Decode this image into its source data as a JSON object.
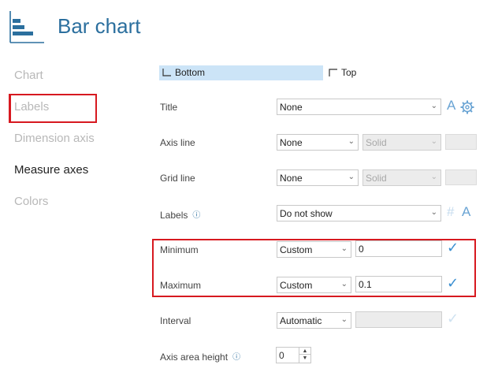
{
  "header": {
    "title": "Bar chart",
    "icon": "bar-chart-icon"
  },
  "nav": {
    "items": [
      {
        "label": "Chart"
      },
      {
        "label": "Labels"
      },
      {
        "label": "Dimension axis"
      },
      {
        "label": "Measure axes"
      },
      {
        "label": "Colors"
      }
    ],
    "active": "Measure axes"
  },
  "position": {
    "bottom_label": "Bottom",
    "top_label": "Top",
    "selected": "Bottom"
  },
  "fields": {
    "title": {
      "label": "Title",
      "value": "None"
    },
    "axis_line": {
      "label": "Axis line",
      "value": "None",
      "style": "Solid"
    },
    "grid_line": {
      "label": "Grid line",
      "value": "None",
      "style": "Solid"
    },
    "labels": {
      "label": "Labels",
      "value": "Do not show"
    },
    "minimum": {
      "label": "Minimum",
      "mode": "Custom",
      "value": "0"
    },
    "maximum": {
      "label": "Maximum",
      "mode": "Custom",
      "value": "0.1"
    },
    "interval": {
      "label": "Interval",
      "mode": "Automatic",
      "value": ""
    },
    "axis_area_height": {
      "label": "Axis area height",
      "value": "0"
    }
  },
  "colors": {
    "accent": "#2b6f9e",
    "highlight": "#d71920",
    "selected_bg": "#cce4f7"
  }
}
